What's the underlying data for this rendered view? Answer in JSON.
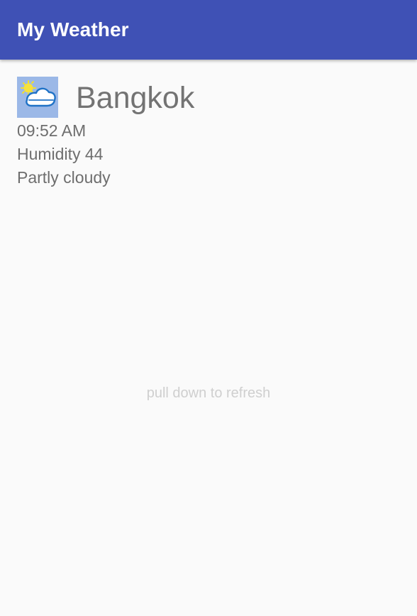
{
  "app_bar": {
    "title": "My Weather",
    "color": "#3f51b5"
  },
  "weather": {
    "icon": "partly-cloudy-icon",
    "city": "Bangkok",
    "time": "09:52 AM",
    "humidity": "Humidity 44",
    "condition": "Partly cloudy"
  },
  "hint": {
    "refresh": "pull down to refresh"
  }
}
